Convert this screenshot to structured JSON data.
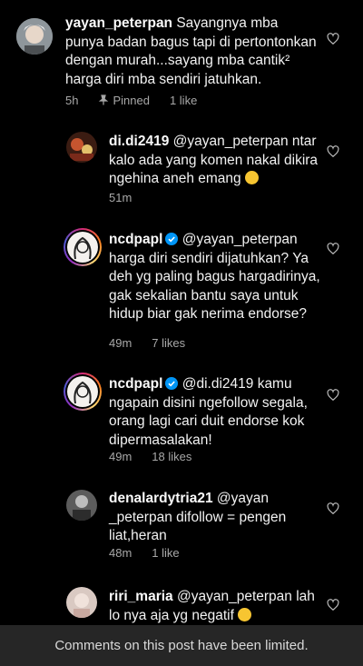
{
  "comments": [
    {
      "username": "yayan_peterpan",
      "text": "Sayangnya mba punya badan bagus tapi di pertontonkan dengan murah...sayang mba cantik² harga diri mba sendiri jatuhkan.",
      "time": "5h",
      "pinned_label": "Pinned",
      "likes": "1 like",
      "verified": false
    },
    {
      "username": "di.di2419",
      "text": "@yayan_peterpan ntar kalo ada yang komen nakal dikira ngehina aneh emang",
      "emoji": "rolling-on-floor-laughing",
      "time": "51m",
      "likes": "",
      "verified": false
    },
    {
      "username": "ncdpapl",
      "text": "@yayan_peterpan harga diri sendiri dijatuhkan? Ya deh yg paling bagus hargadirinya, gak sekalian bantu saya untuk hidup biar gak nerima endorse?",
      "time": "49m",
      "likes": "7 likes",
      "verified": true
    },
    {
      "username": "ncdpapl",
      "text": "@di.di2419 kamu ngapain disini ngefollow segala, orang lagi cari duit endorse kok dipermasalakan!",
      "time": "49m",
      "likes": "18 likes",
      "verified": true
    },
    {
      "username": "denalardytria21",
      "text": "@yayan _peterpan difollow = pengen liat,heran",
      "time": "48m",
      "likes": "1 like",
      "verified": false
    },
    {
      "username": "riri_maria",
      "text": "@yayan_peterpan lah lo nya aja yg negatif",
      "emoji": "smiling-with-sweat",
      "time": "",
      "likes": "",
      "verified": false
    }
  ],
  "footer": {
    "notice": "Comments on this post have been limited."
  },
  "colors": {
    "background": "#000000",
    "text": "#f5f5f5",
    "meta": "#a8a8a8",
    "footer_bg": "#262626",
    "verified": "#0095f6"
  }
}
